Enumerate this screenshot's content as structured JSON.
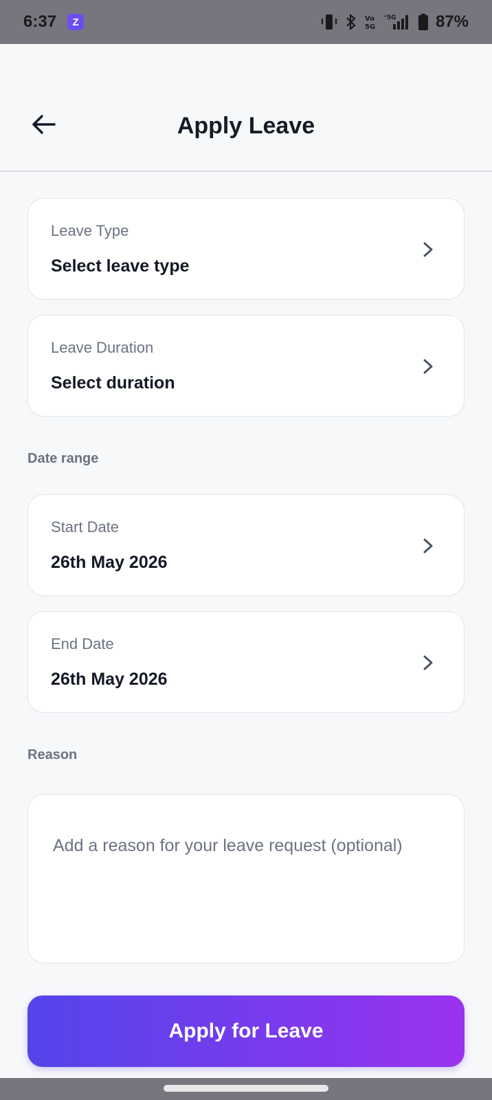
{
  "status_bar": {
    "time": "6:37",
    "app_badge": "Z",
    "battery": "87%",
    "network": "5G",
    "volte": "Vo 5G"
  },
  "header": {
    "title": "Apply Leave",
    "back_icon": "arrow-left-icon"
  },
  "form": {
    "leave_type": {
      "label": "Leave Type",
      "value": "Select leave type"
    },
    "leave_duration": {
      "label": "Leave Duration",
      "value": "Select duration"
    },
    "date_range_title": "Date range",
    "start_date": {
      "label": "Start Date",
      "value": "26th May 2026"
    },
    "end_date": {
      "label": "End Date",
      "value": "26th May 2026"
    },
    "reason_title": "Reason",
    "reason_placeholder": "Add a reason for your leave request (optional)",
    "reason_value": ""
  },
  "actions": {
    "apply_label": "Apply for Leave"
  },
  "colors": {
    "accent_start": "#5345ea",
    "accent_end": "#9b32ee",
    "background": "#f7f8fa"
  }
}
